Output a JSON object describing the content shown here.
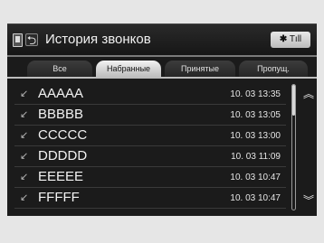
{
  "header": {
    "title": "История звонков",
    "status": {
      "bt_symbol": "✱",
      "signal": "Tıll"
    }
  },
  "tabs": [
    {
      "label": "Все",
      "active": false
    },
    {
      "label": "Набранные",
      "active": true
    },
    {
      "label": "Принятые",
      "active": false
    },
    {
      "label": "Пропущ.",
      "active": false
    }
  ],
  "list": {
    "items": [
      {
        "name": "AAAAA",
        "time": "10. 03  13:35"
      },
      {
        "name": "BBBBB",
        "time": "10. 03  13:05"
      },
      {
        "name": "CCCCC",
        "time": "10. 03  13:00"
      },
      {
        "name": "DDDDD",
        "time": "10. 03  11:09"
      },
      {
        "name": "EEEEE",
        "time": "10. 03  10:47"
      },
      {
        "name": "FFFFF",
        "time": "10. 03  10:47"
      }
    ]
  },
  "icons": {
    "up": "︽",
    "down": "︾",
    "back": "⮌",
    "call": "↙"
  }
}
